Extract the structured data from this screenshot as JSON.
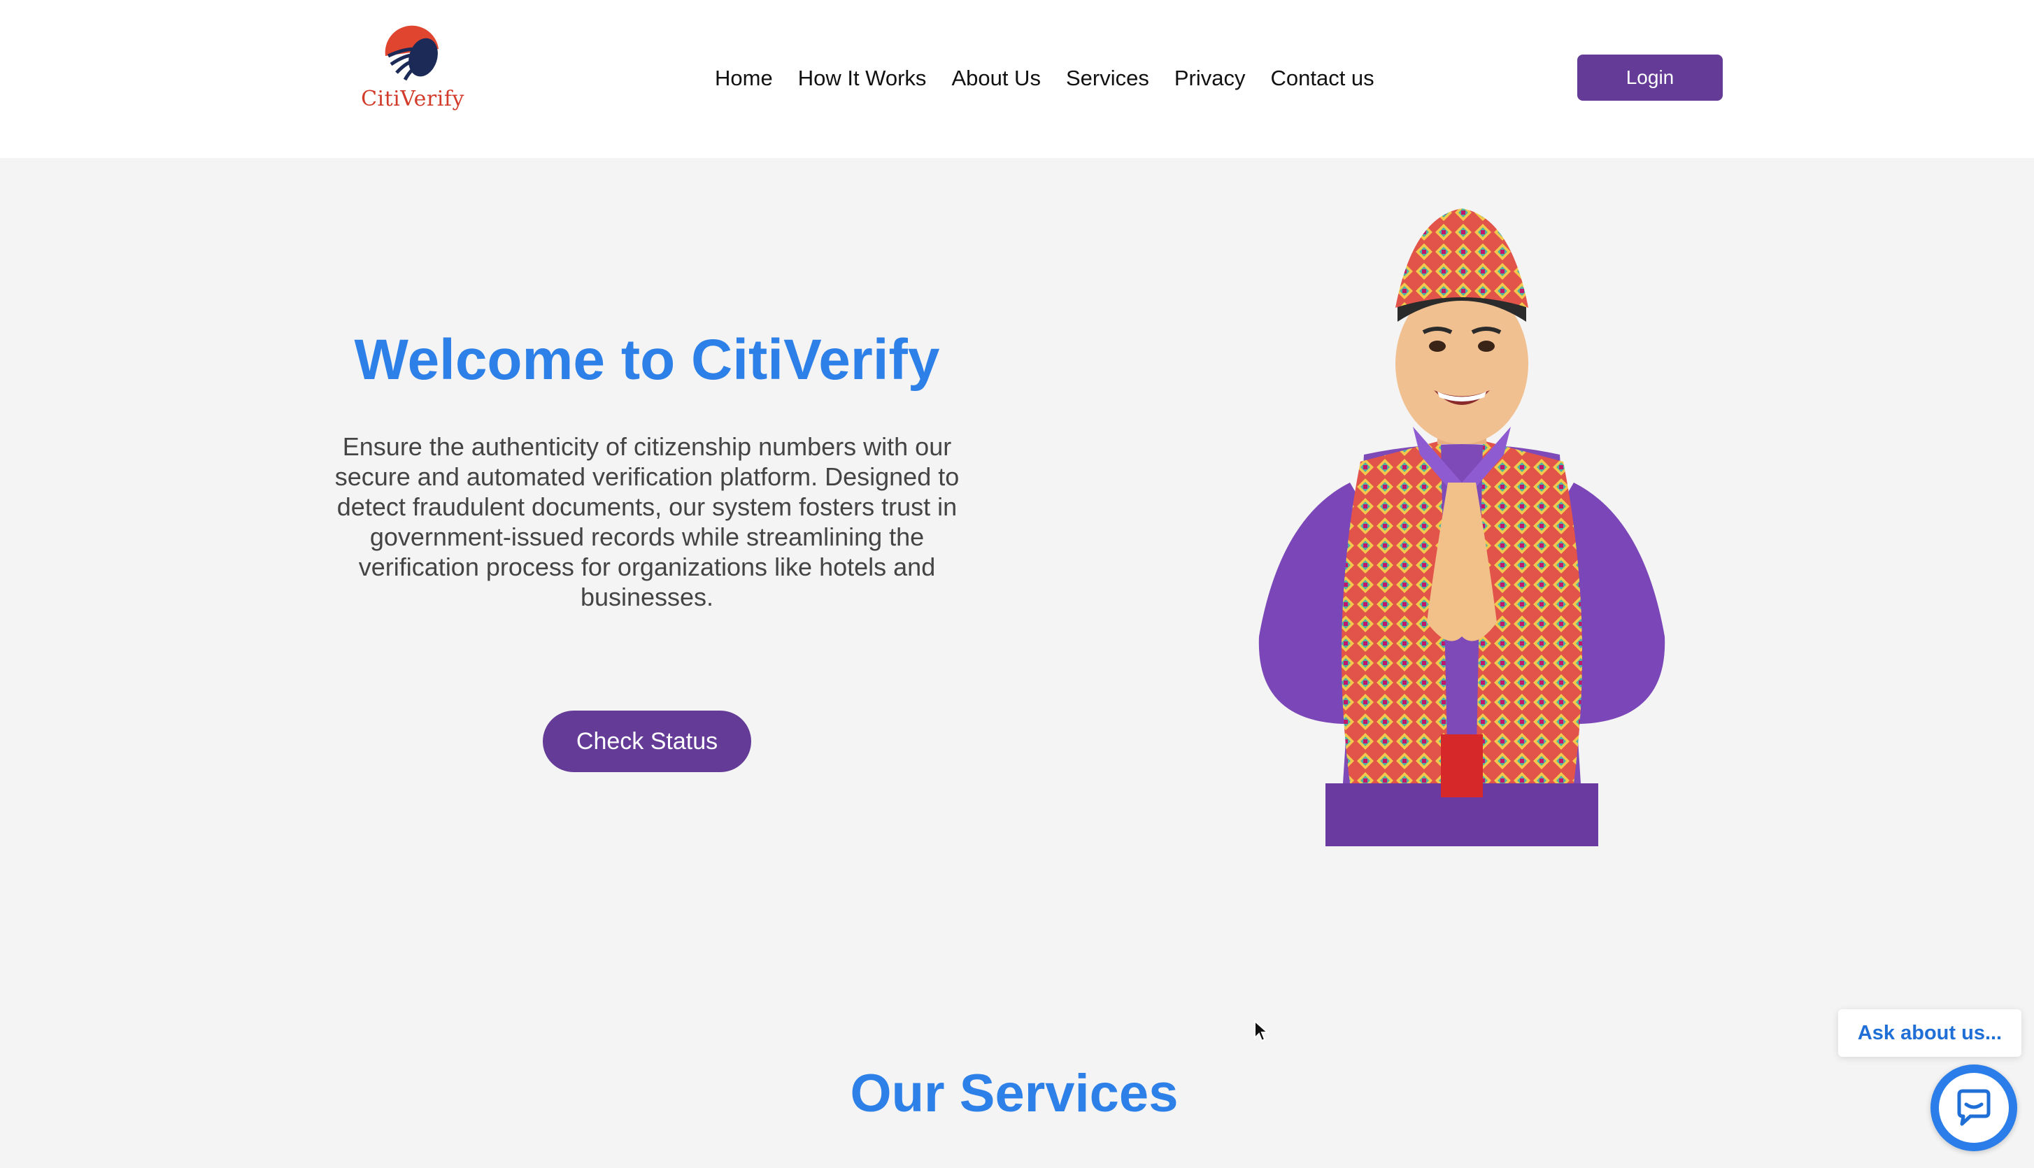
{
  "header": {
    "logo_text": "CitiVerify",
    "nav": [
      "Home",
      "How It Works",
      "About Us",
      "Services",
      "Privacy",
      "Contact us"
    ],
    "login_label": "Login"
  },
  "hero": {
    "title": "Welcome to CitiVerify",
    "description": "Ensure the authenticity of citizenship numbers with our secure and automated verification platform. Designed to detect fraudulent documents, our system fosters trust in government-issued records while streamlining the verification process for organizations like hotels and businesses.",
    "button_label": "Check Status"
  },
  "services": {
    "title": "Our Services"
  },
  "chat": {
    "bubble_text": "Ask about us..."
  },
  "colors": {
    "accent_blue": "#2d80e8",
    "button_purple": "#643c98",
    "logo_red": "#d23a2a",
    "logo_navy": "#1b2a57"
  }
}
